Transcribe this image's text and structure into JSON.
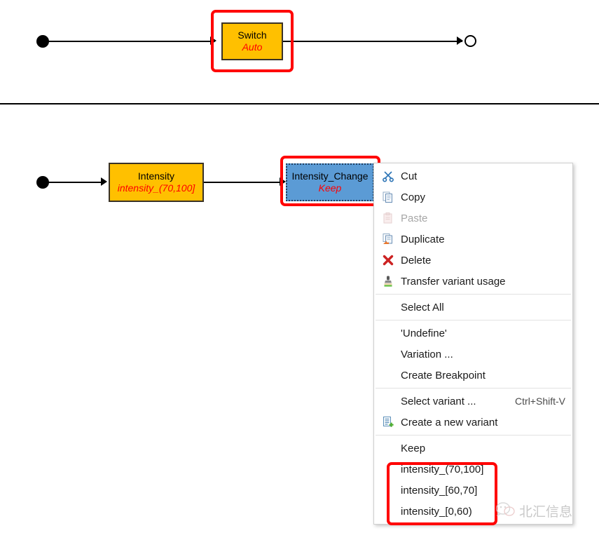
{
  "diagram_top": {
    "start_node": "filled-start-node",
    "end_node": "hollow-end-node",
    "block": {
      "title": "Switch",
      "subtitle": "Auto",
      "fill_color": "#FFC000",
      "text_color": "#000000",
      "subtitle_color": "#FF0000"
    },
    "highlight_color": "#FF0000"
  },
  "diagram_bottom": {
    "start_node": "filled-start-node",
    "blocks": [
      {
        "title": "Intensity",
        "subtitle": "intensity_(70,100]",
        "fill_color": "#FFC000",
        "selected": false
      },
      {
        "title": "Intensity_Change",
        "subtitle": "Keep",
        "fill_color": "#5B9BD5",
        "selected": true
      }
    ],
    "highlight_color": "#FF0000"
  },
  "context_menu": {
    "groups": [
      {
        "items": [
          {
            "label": "Cut",
            "icon": "scissors-icon",
            "enabled": true,
            "accel": ""
          },
          {
            "label": "Copy",
            "icon": "copy-icon",
            "enabled": true,
            "accel": ""
          },
          {
            "label": "Paste",
            "icon": "paste-icon",
            "enabled": false,
            "accel": ""
          },
          {
            "label": "Duplicate",
            "icon": "duplicate-icon",
            "enabled": true,
            "accel": ""
          },
          {
            "label": "Delete",
            "icon": "delete-cross-icon",
            "enabled": true,
            "accel": ""
          },
          {
            "label": "Transfer variant usage",
            "icon": "stamp-icon",
            "enabled": true,
            "accel": ""
          }
        ]
      },
      {
        "items": [
          {
            "label": "Select All",
            "icon": "",
            "enabled": true,
            "accel": ""
          }
        ]
      },
      {
        "items": [
          {
            "label": "'Undefine'",
            "icon": "",
            "enabled": true,
            "accel": ""
          },
          {
            "label": "Variation ...",
            "icon": "",
            "enabled": true,
            "accel": ""
          },
          {
            "label": "Create Breakpoint",
            "icon": "",
            "enabled": true,
            "accel": ""
          }
        ]
      },
      {
        "items": [
          {
            "label": "Select variant ...",
            "icon": "",
            "enabled": true,
            "accel": "Ctrl+Shift-V"
          },
          {
            "label": "Create a new variant",
            "icon": "new-variant-icon",
            "enabled": true,
            "accel": ""
          }
        ]
      },
      {
        "items": [
          {
            "label": "Keep",
            "icon": "",
            "enabled": true,
            "accel": ""
          },
          {
            "label": "intensity_(70,100]",
            "icon": "",
            "enabled": true,
            "accel": ""
          },
          {
            "label": "intensity_[60,70]",
            "icon": "",
            "enabled": true,
            "accel": ""
          },
          {
            "label": "intensity_[0,60)",
            "icon": "",
            "enabled": true,
            "accel": ""
          }
        ]
      }
    ],
    "variant_highlight_color": "#FF0000"
  },
  "watermark": {
    "text": "北汇信息",
    "logo": "wechat-icon",
    "color": "#C9C9C9"
  }
}
